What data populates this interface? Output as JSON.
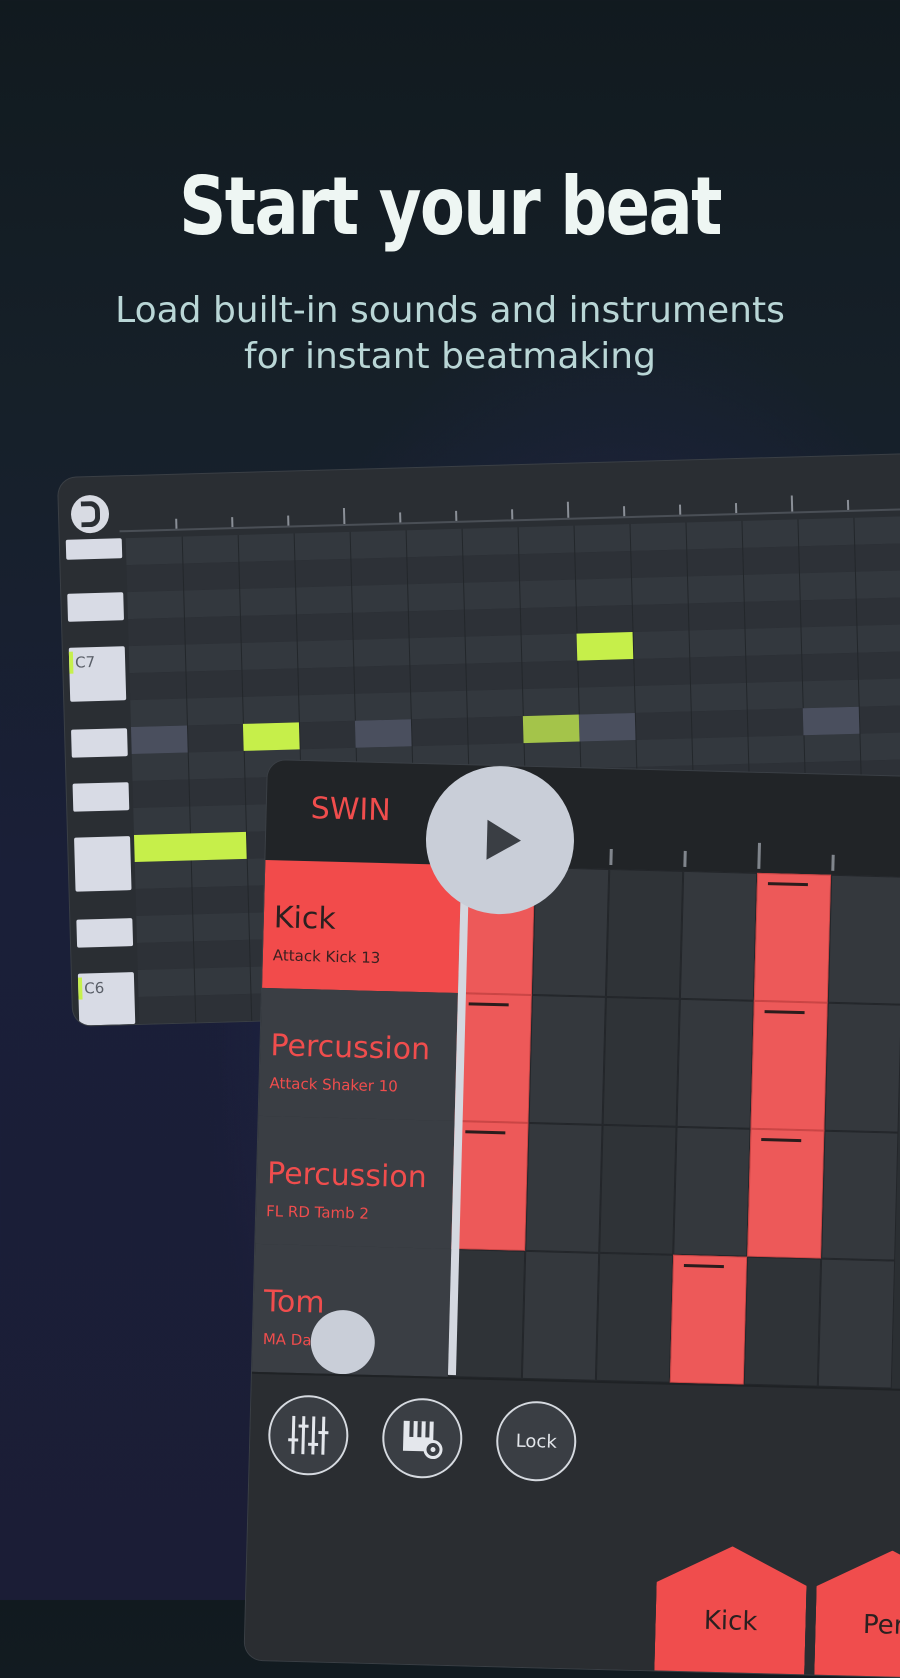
{
  "hero": {
    "title": "Start your beat",
    "subtitle_line1": "Load built-in sounds and instruments",
    "subtitle_line2": "for instant beatmaking"
  },
  "piano_roll": {
    "magnet_icon": "magnet-icon",
    "key_labels": {
      "c7": "C7",
      "c6": "C6"
    }
  },
  "step_sequencer": {
    "swing_label": "SWIN",
    "play_icon": "play-icon",
    "tracks": [
      {
        "name": "Kick",
        "sample": "Attack Kick 13",
        "active": true
      },
      {
        "name": "Percussion",
        "sample": "Attack Shaker 10",
        "active": false
      },
      {
        "name": "Percussion",
        "sample": "FL RD Tamb 2",
        "active": false
      },
      {
        "name": "Tom",
        "sample": "MA Da          om",
        "active": false
      }
    ],
    "toolbar": {
      "mixer_icon": "mixer-sliders-icon",
      "piano_settings_icon": "piano-settings-icon",
      "lock_label": "Lock"
    },
    "pads": {
      "kick_label": "Kick",
      "perc_label": "Perc"
    }
  },
  "colors": {
    "accent_red": "#f04d4d",
    "note_green": "#c6ef4a",
    "background": "#141b22"
  }
}
